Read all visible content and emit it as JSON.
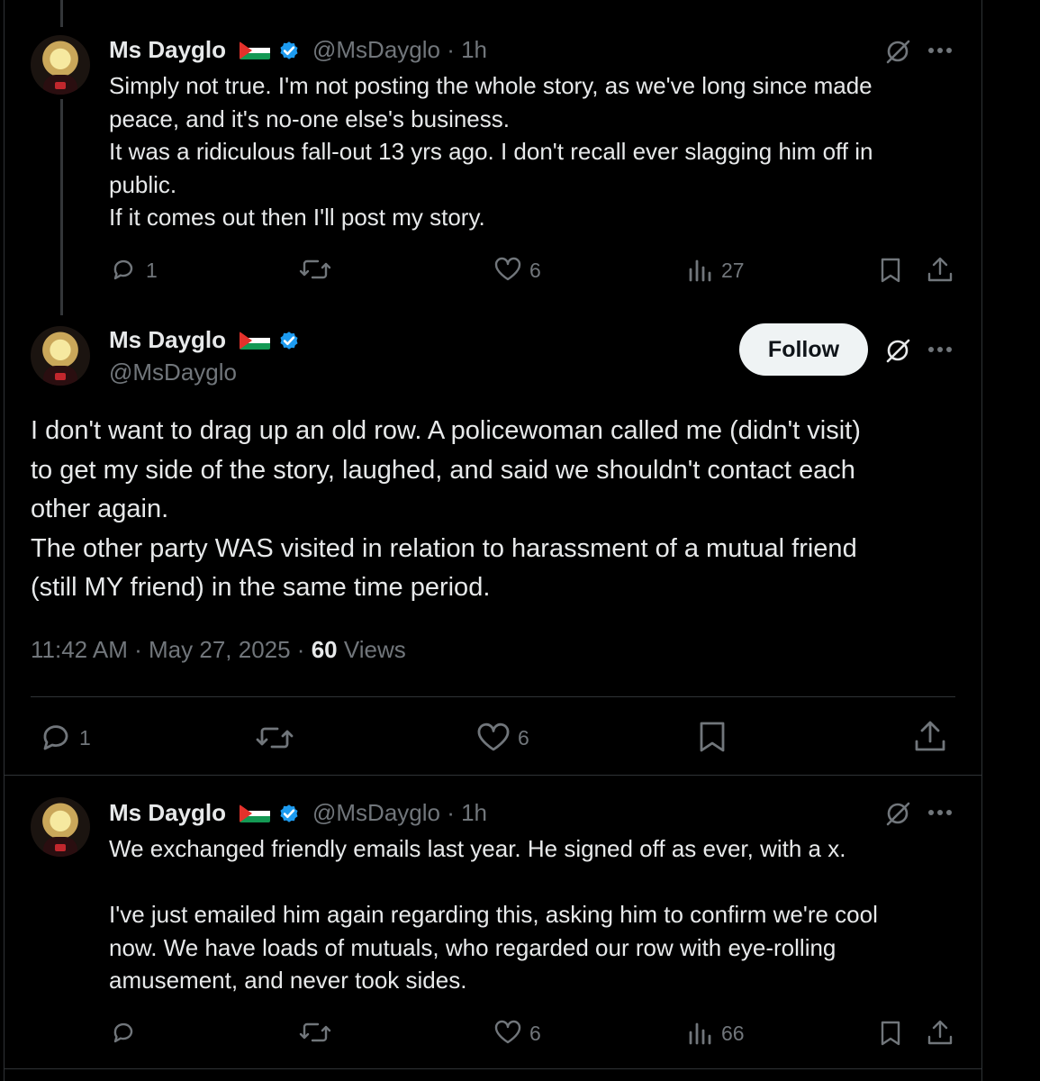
{
  "colors": {
    "background": "#000000",
    "text": "#e7e9ea",
    "muted": "#71767b",
    "verified": "#1d9bf0",
    "divider": "#2f3336"
  },
  "reply_top": {
    "name": "Ms Dayglo",
    "handle_time": "@MsDayglo · 1h",
    "text": "Simply not true. I'm not posting the whole story, as we've long since made\npeace, and it's no-one else's business.\nIt was a ridiculous fall-out 13 yrs ago. I don't recall ever slagging him off in\npublic.\nIf it comes out then I'll post my story.",
    "replies": "1",
    "likes": "6",
    "views": "27",
    "icons": [
      "reply-icon",
      "repost-icon",
      "like-icon",
      "views-icon",
      "bookmark-icon",
      "share-icon",
      "grok-icon",
      "more-icon"
    ]
  },
  "main_post": {
    "name": "Ms Dayglo",
    "handle": "@MsDayglo",
    "follow_label": "Follow",
    "text": "I don't want to drag up an old row. A policewoman called me (didn't visit)\nto get my side of the story, laughed, and said we shouldn't contact each\nother again.\nThe other party WAS visited in relation to harassment of a mutual friend\n(still MY friend) in the same time period.",
    "time": "11:42 AM · May 27, 2025 · ",
    "views_count": "60",
    "views_label": " Views",
    "replies": "1",
    "likes": "6"
  },
  "reply_bottom": {
    "name": "Ms Dayglo",
    "handle_time": "@MsDayglo · 1h",
    "text": "We exchanged friendly emails last year. He signed off as ever, with a x.\n\nI've just emailed him again regarding this, asking him to confirm we're cool\nnow. We have loads of mutuals, who regarded our row with eye-rolling\namusement, and never took sides.",
    "likes": "6",
    "views": "66"
  }
}
